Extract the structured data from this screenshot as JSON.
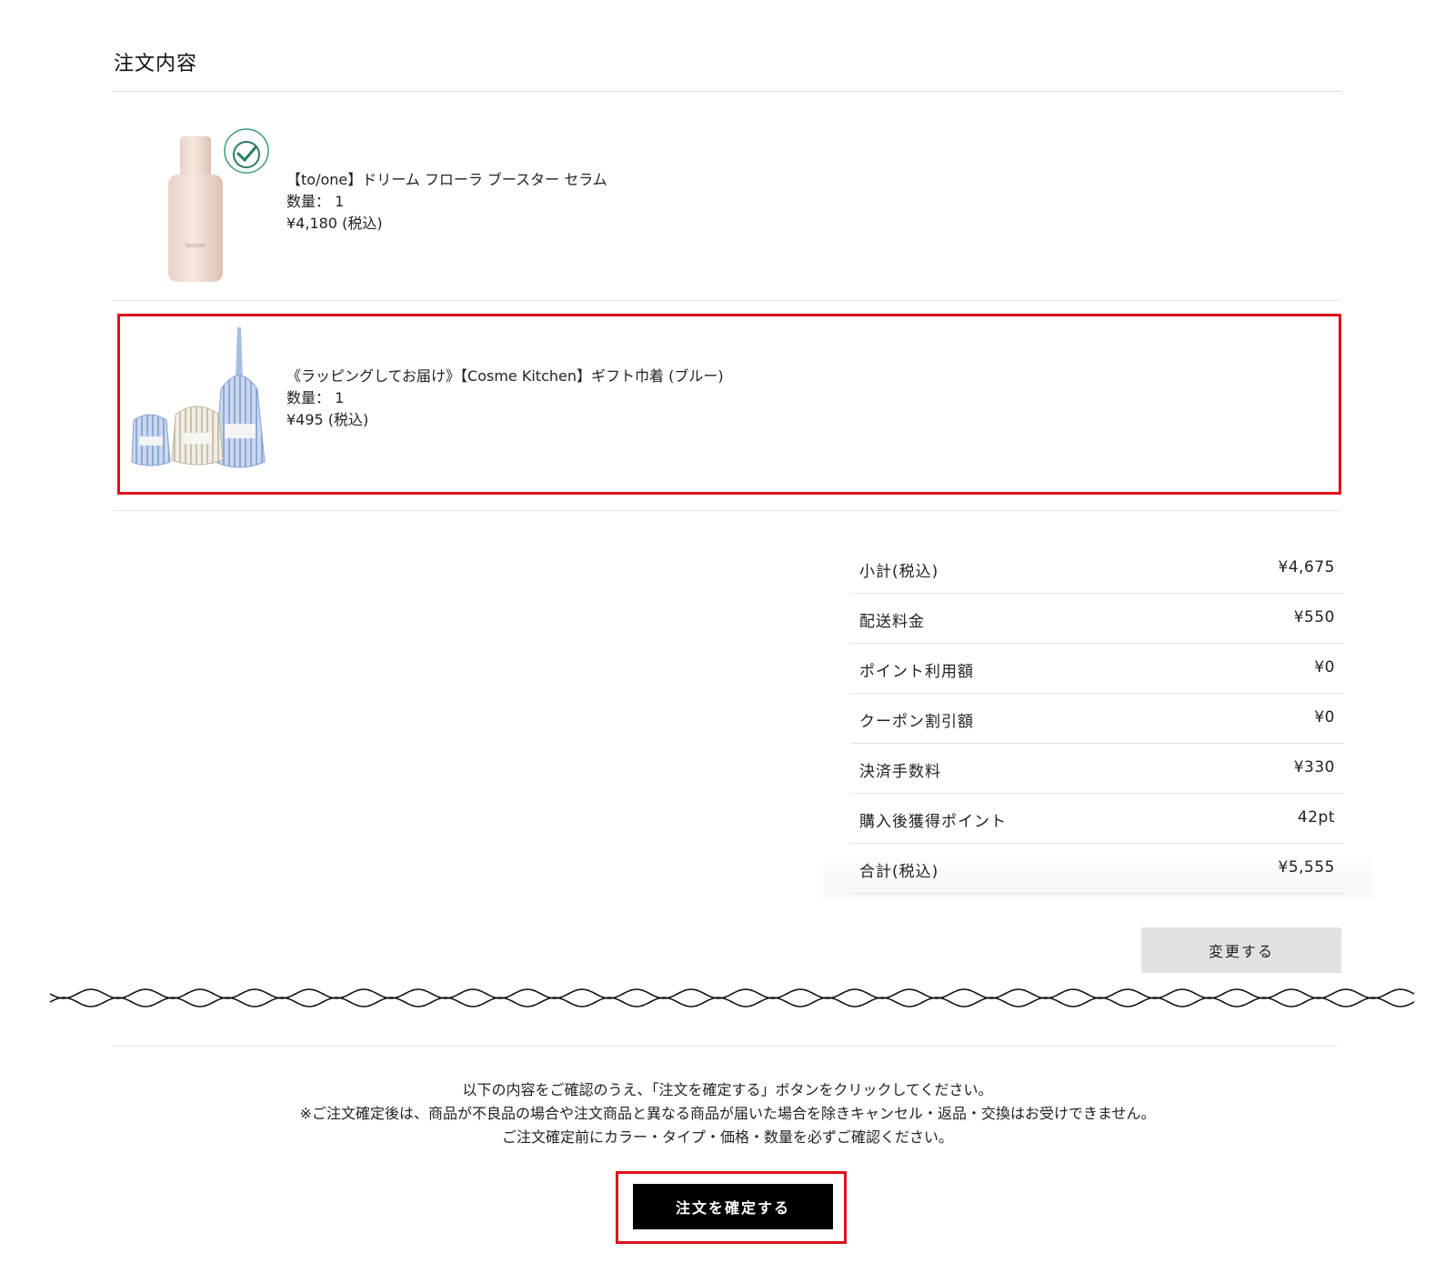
{
  "order": {
    "section_title": "注文内容",
    "items": [
      {
        "name": "【to/one】ドリーム フローラ ブースター セラム",
        "quantity_label": "数量： 1",
        "price_label": "¥4,180 (税込)",
        "image_text": "to/one"
      },
      {
        "name": "《ラッピングしてお届け》【Cosme Kitchen】ギフト巾着 (ブルー)",
        "quantity_label": "数量： 1",
        "price_label": "¥495 (税込)"
      }
    ]
  },
  "summary": {
    "rows": [
      {
        "label": "小計(税込)",
        "value": "¥4,675"
      },
      {
        "label": "配送料金",
        "value": "¥550"
      },
      {
        "label": "ポイント利用額",
        "value": "¥0"
      },
      {
        "label": "クーポン割引額",
        "value": "¥0"
      },
      {
        "label": "決済手数料",
        "value": "¥330"
      },
      {
        "label": "購入後獲得ポイント",
        "value": "42pt"
      },
      {
        "label": "合計(税込)",
        "value": "¥5,555"
      }
    ],
    "change_button_label": "変更する"
  },
  "confirm": {
    "notes": [
      "以下の内容をご確認のうえ、「注文を確定する」ボタンをクリックしてください。",
      "※ご注文確定後は、商品が不良品の場合や注文商品と異なる商品が届いた場合を除きキャンセル・返品・交換はお受けできません。",
      "ご注文確定前にカラー・タイプ・価格・数量を必ずご確認ください。"
    ],
    "button_label": "注文を確定する"
  },
  "colors": {
    "highlight": "#e0101a",
    "confirm_button_bg": "#000000",
    "change_button_bg": "#e2e2e2"
  }
}
